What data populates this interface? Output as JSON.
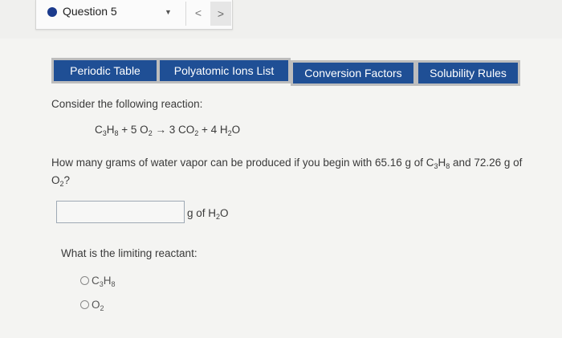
{
  "question_nav": {
    "label": "Question 5",
    "prev": "<",
    "next": ">"
  },
  "tabs": [
    "Periodic Table",
    "Polyatomic Ions List",
    "Conversion Factors",
    "Solubility Rules"
  ],
  "content": {
    "prompt": "Consider the following reaction:",
    "equation": {
      "r1_pre": "C",
      "r1_s1": "3",
      "r1_mid": "H",
      "r1_s2": "8",
      "plus1": " + 5 O",
      "o2_sub": "2",
      "arrow": " → 3 CO",
      "co2_sub": "2",
      "plus2": " + 4 H",
      "h2o_sub": "2",
      "h2o_end": "O"
    },
    "question": {
      "p1": "How many grams of water vapor can be produced if you begin with 65.16 g of C",
      "s1": "3",
      "p2": "H",
      "s2": "8",
      "p3": " and 72.26 g of",
      "p4": "O",
      "s3": "2",
      "p5": "?"
    },
    "answer": {
      "value": "",
      "unit_pre": "g of H",
      "unit_sub": "2",
      "unit_end": "O"
    },
    "limiting_question": "What is the limiting reactant:",
    "options": [
      {
        "a": "C",
        "s1": "3",
        "b": "H",
        "s2": "8"
      },
      {
        "a": "O",
        "s1": "2"
      }
    ]
  }
}
